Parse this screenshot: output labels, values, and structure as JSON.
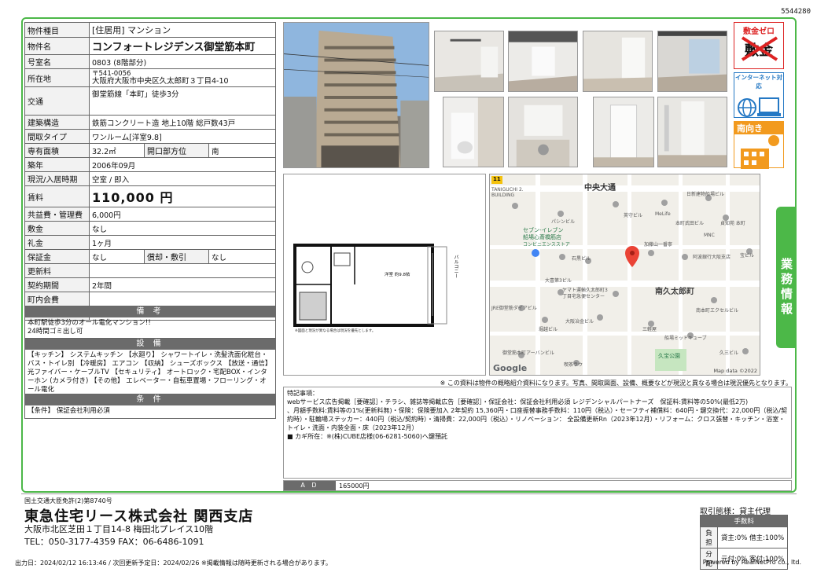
{
  "property_id": "5544280",
  "spec": {
    "type_label": "物件種目",
    "type_value": "[住居用] マンション",
    "name_label": "物件名",
    "name_value": "コンフォートレジデンス御堂筋本町",
    "room_label": "号室名",
    "room_value": "0803 (8階部分)",
    "address_label": "所在地",
    "postal": "〒541-0056",
    "address_value": "大阪府大阪市中央区久太郎町３丁目4-10",
    "transport_label": "交通",
    "transport_value": "御堂筋線「本町」徒歩3分",
    "structure_label": "建築構造",
    "structure_value": "鉄筋コンクリート造 地上10階 総戸数43戸",
    "layout_label": "間取タイプ",
    "layout_value": "ワンルーム[洋室9.8]",
    "area_label": "専有面積",
    "area_value": "32.2㎡",
    "direction_label": "開口部方位",
    "direction_value": "南",
    "built_label": "築年",
    "built_value": "2006年09月",
    "status_label": "現況/入居時期",
    "status_value": "空室 / 即入",
    "rent_label": "賃料",
    "rent_value": "110,000 円",
    "fee_label": "共益費・管理費",
    "fee_value": "6,000円",
    "deposit_label": "敷金",
    "deposit_value": "なし",
    "key_label": "礼金",
    "key_value": "1ヶ月",
    "security_label": "保証金",
    "security_value": "なし",
    "amort_label": "償却・敷引",
    "amort_value": "なし",
    "renew_label": "更新料",
    "renew_value": "",
    "contract_label": "契約期間",
    "contract_value": "2年間",
    "assoc_label": "町内会費",
    "assoc_value": "",
    "parking_label": "駐車場",
    "parking_value": "－－"
  },
  "remarks": {
    "title": "備 考",
    "line1": "本町駅徒歩3分のオール電化マンション!!",
    "line2": "24時間ゴミ出し可"
  },
  "facilities": {
    "title": "設 備",
    "text": "【キッチン】 システムキッチン 【水廻り】 シャワートイレ・洗髪洗面化粧台・バス・トイレ別 【冷暖房】 エアコン 【収納】 シューズボックス 【放送・通信】 光ファイバー・ケーブルTV 【セキュリティ】 オートロック・宅配BOX・インターホン (カメラ付き) 【その他】 エレベーター・自転車置場・フローリング・オール電化"
  },
  "conditions": {
    "title": "条 件",
    "text": "【条件】 保証会社利用必須"
  },
  "badges": {
    "deposit_zero": "敷金ゼロ",
    "deposit_big": "敷金",
    "internet": "インターネット対応",
    "south": "南向き"
  },
  "side_tab": "業務情報",
  "floorplan": {
    "room_label": "洋室 約9.8帖",
    "balcony": "バルコニー",
    "note": "※図面と現況が異なる場合は現況を優先とします。"
  },
  "map": {
    "main_road": "中央大通",
    "road_badge": "11",
    "lower_area": "南久太郎町",
    "place_labels": [
      "TANIGUCHI 2. BUILDING",
      "日新建物船場ビル",
      "パシンビル",
      "英守ビル",
      "MeLife",
      "本町武田ビル",
      "貞知苑 本町",
      "セブン-イレブン",
      "船場心斎橋筋店",
      "コンビニエンスストア",
      "MNC",
      "宝ビル",
      "加藤山一番寧",
      "阿波銀行大阪支店",
      "石黒ビル",
      "大喜第3ビル",
      "ヤマト運輸久太郎町3",
      "丁目宅急便センター",
      "JRE御堂筋ダイアビル",
      "南本町エクセルビル",
      "堀越ビル",
      "大阪冶金ビル",
      "三軽屋",
      "船場ミッドキューブ",
      "御堂筋本町アーバンビル",
      "久宝公園",
      "久三ビル",
      "喫茶ラウ"
    ],
    "footer": "Map data ©2022",
    "google": "Google"
  },
  "disclaimer": "※ この資料は物件の概略紹介資料になります。写真、間取図面、設備、概要などが現況と異なる場合は現況優先となります。",
  "notes": {
    "title": "特記事項：",
    "line1": "webサービス広告掲載［要確認］・チラシ、雑誌等掲載広告［要確認］・保証会社：保証会社利用必須 レジデンシャルパートナーズ　保証料:賃料等の50%(最低2万)",
    "line2": "、月額手数料:賃料等の1%(更新料無)・保険：保険要加入 2年契約 15,360円・口座振替事務手数料：110円（税込）・セーフティ補償料：640円・鍵交換代：22,000円（税込/契約時）・駐輪場ステッカー：440円（税込/契約時）・清掃費：22,000円（税込）・リノベーション： 全設備更新Rn（2023年12月）・リフォーム：クロス張替・キッチン・浴室・トイレ・洗面・内装全面・床（2023年12月）",
    "line3": "■ カギ所在：※(株)CUBE店様(06-6281-5060)へ鍵預託"
  },
  "ad": {
    "label": "A D",
    "value": "165000円"
  },
  "company": {
    "license": "国土交通大臣免許(2)第8740号",
    "name": "東急住宅リース株式会社 関西支店",
    "address": "大阪市北区芝田１丁目14-8 梅田北プレイス10階",
    "tel": "TEL：050-3177-4359 FAX：06-6486-1091"
  },
  "deal": {
    "title": "取引態様：貸主代理",
    "fee_header": "手数料",
    "burden_label": "負担",
    "burden_value": "貸主:0% 借主:100%",
    "split_label": "分配",
    "split_value": "元付:0% 客付:100%"
  },
  "output_info": "出力日：2024/02/12 16:13:46 / 次回更新予定日：2024/02/26 ※掲載情報は随時更新される場合があります。",
  "powered": "Powered by RealNetPro co., ltd."
}
